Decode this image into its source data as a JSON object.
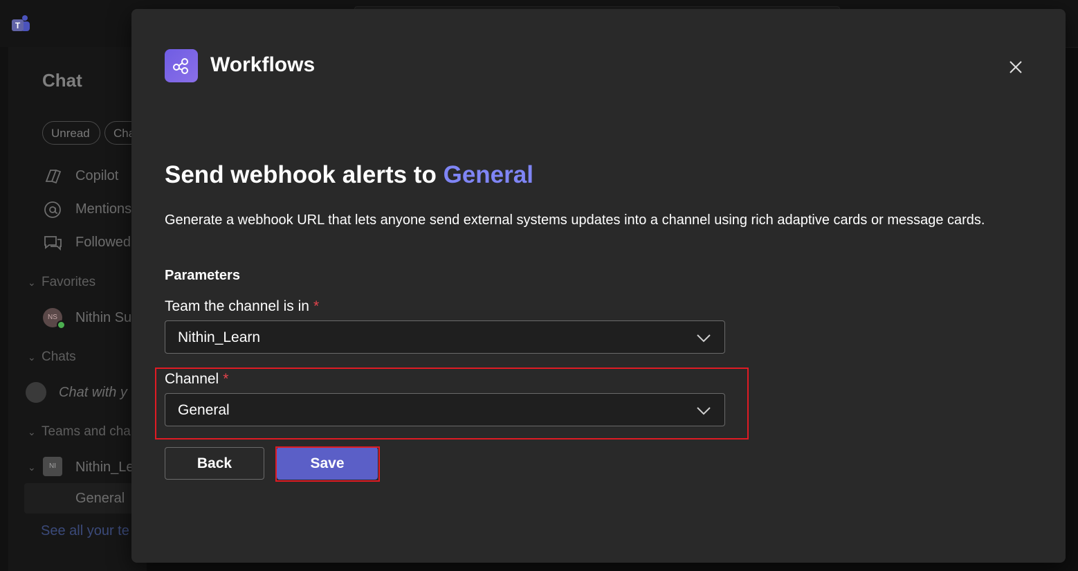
{
  "background": {
    "chat_title": "Chat",
    "filters": [
      "Unread",
      "Cha"
    ],
    "nav": [
      "Copilot",
      "Mentions",
      "Followed"
    ],
    "favorites_label": "Favorites",
    "favorite_contact": "Nithin Su",
    "favorite_initials": "NS",
    "chats_label": "Chats",
    "chat_item": "Chat with y",
    "teams_label": "Teams and cha",
    "team_name": "Nithin_Le",
    "team_initials": "NI",
    "channel_name": "General",
    "see_all": "See all your te"
  },
  "modal": {
    "app_name": "Workflows",
    "heading_prefix": "Send webhook alerts to",
    "heading_channel": "General",
    "description": "Generate a webhook URL that lets anyone send external systems updates into a channel using rich adaptive cards or message cards.",
    "parameters_label": "Parameters",
    "team_field": {
      "label": "Team the channel is in",
      "required_mark": "*",
      "value": "Nithin_Learn"
    },
    "channel_field": {
      "label": "Channel",
      "required_mark": "*",
      "value": "General"
    },
    "back_label": "Back",
    "save_label": "Save"
  },
  "colors": {
    "accent": "#7f85f5",
    "primary_button": "#5b5fc7",
    "required": "#e2434c",
    "highlight": "#e01b24"
  },
  "icons": [
    "teams-logo-icon",
    "copilot-icon",
    "mention-icon",
    "followed-icon",
    "workflows-icon",
    "close-icon",
    "chevron-down-icon"
  ]
}
